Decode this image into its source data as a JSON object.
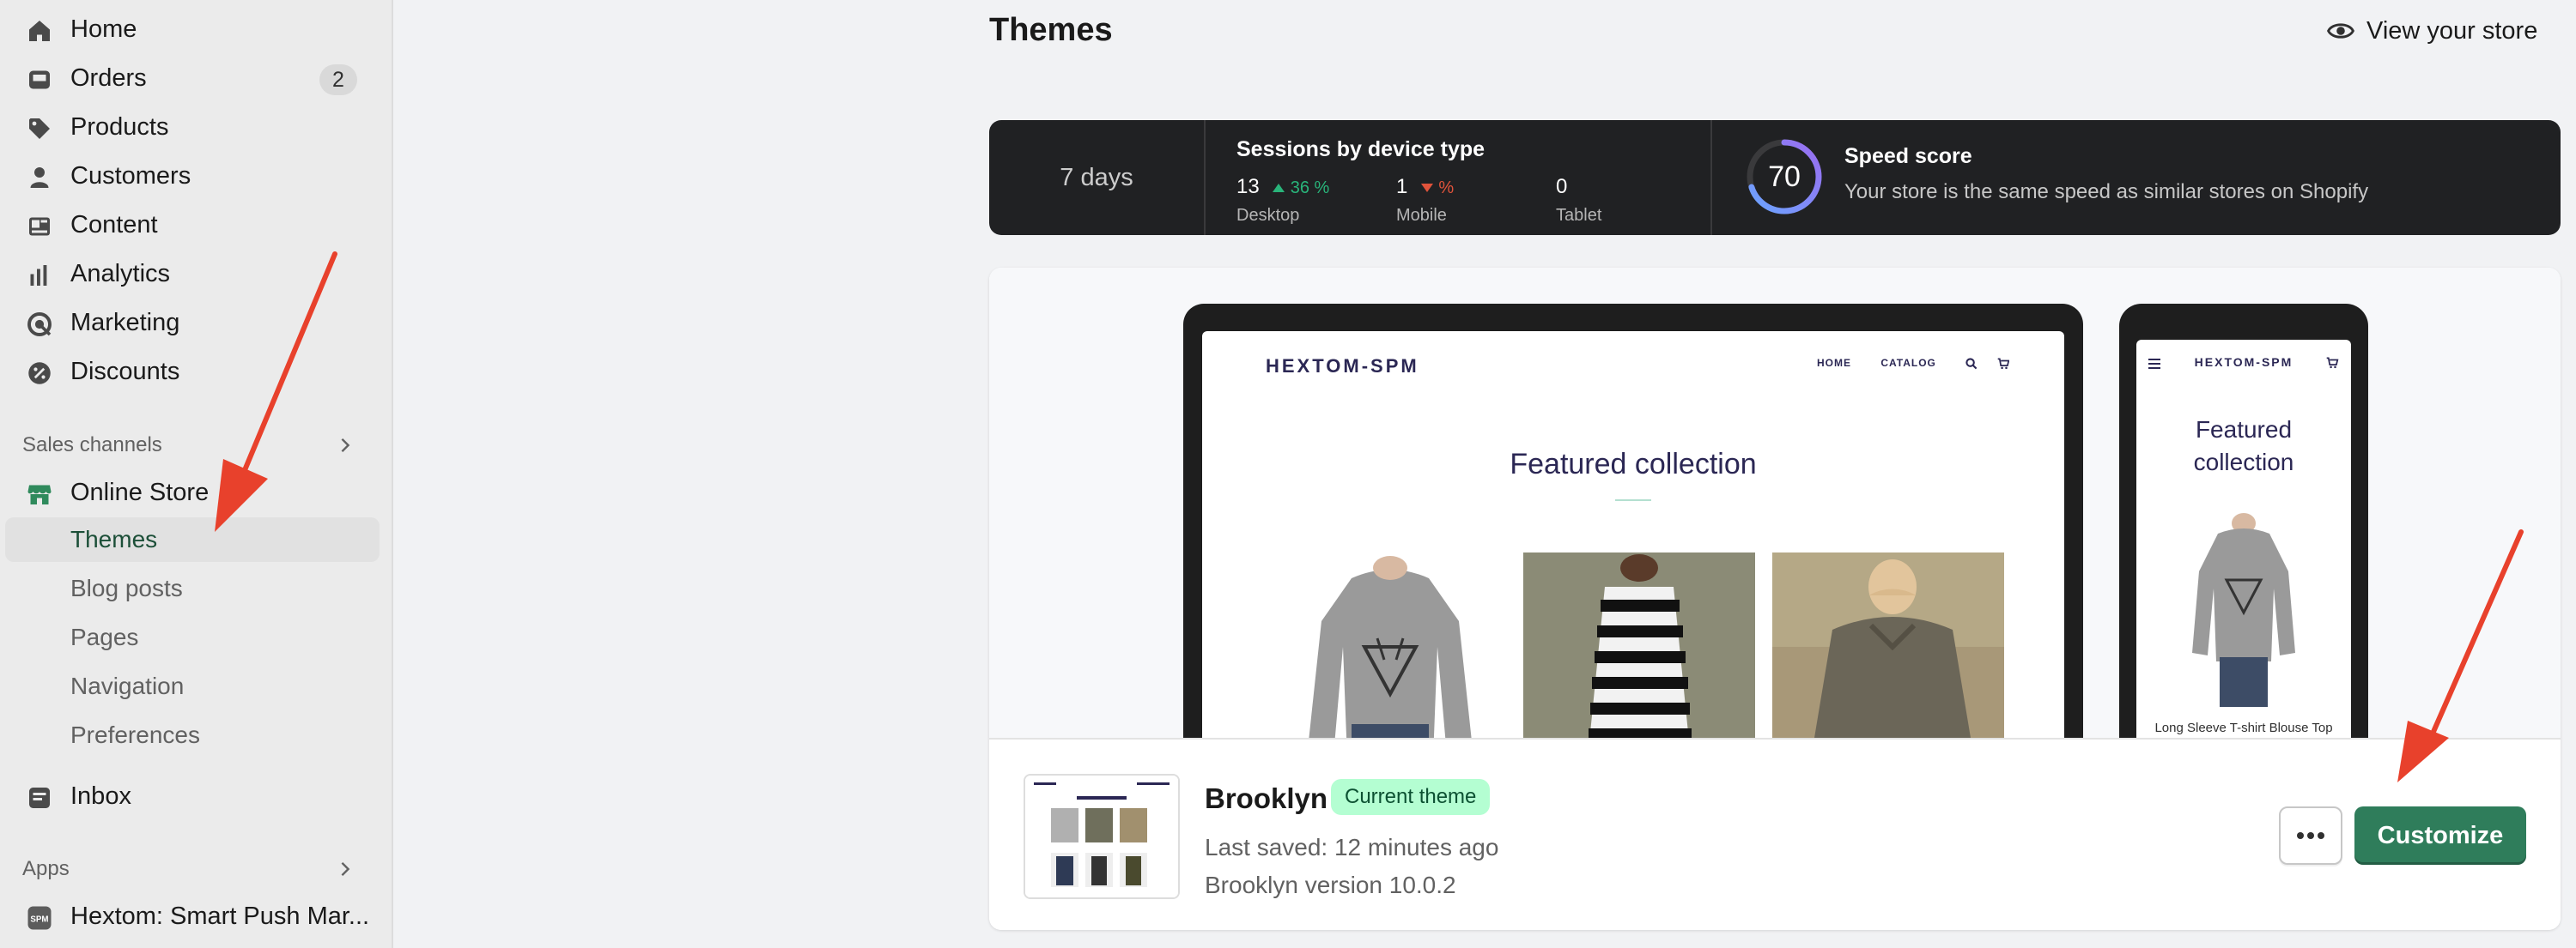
{
  "sidebar": {
    "items": [
      {
        "label": "Home",
        "icon": "home-icon"
      },
      {
        "label": "Orders",
        "icon": "inbox-tray-icon",
        "badge": "2"
      },
      {
        "label": "Products",
        "icon": "tag-icon"
      },
      {
        "label": "Customers",
        "icon": "person-icon"
      },
      {
        "label": "Content",
        "icon": "layout-icon"
      },
      {
        "label": "Analytics",
        "icon": "bar-chart-icon"
      },
      {
        "label": "Marketing",
        "icon": "target-icon"
      },
      {
        "label": "Discounts",
        "icon": "discount-icon"
      }
    ],
    "sales_channels": {
      "heading": "Sales channels",
      "online_store": "Online Store",
      "sub_items": [
        "Themes",
        "Blog posts",
        "Pages",
        "Navigation",
        "Preferences"
      ],
      "active": "Themes"
    },
    "inbox": "Inbox",
    "apps": {
      "heading": "Apps",
      "items": [
        {
          "label": "Hextom: Smart Push Mar...",
          "icon_text": "SPM"
        }
      ]
    }
  },
  "header": {
    "title": "Themes",
    "view_store": "View your store"
  },
  "stats": {
    "period": "7 days",
    "sessions_title": "Sessions by device type",
    "devices": [
      {
        "count": "13",
        "change": "36 %",
        "trend": "up",
        "label": "Desktop"
      },
      {
        "count": "1",
        "change": "%",
        "trend": "down",
        "label": "Mobile"
      },
      {
        "count": "0",
        "change": "",
        "trend": "none",
        "label": "Tablet"
      }
    ],
    "speed_score": 70,
    "speed_title": "Speed score",
    "speed_desc": "Your store is the same speed as similar stores on Shopify"
  },
  "preview": {
    "logo": "HEXTOM-SPM",
    "nav": [
      "HOME",
      "CATALOG"
    ],
    "featured": "Featured collection",
    "mobile_featured_line1": "Featured",
    "mobile_featured_line2": "collection",
    "mobile_caption": "Long Sleeve T-shirt Blouse Top"
  },
  "theme": {
    "name": "Brooklyn",
    "badge": "Current theme",
    "last_saved": "Last saved: 12 minutes ago",
    "version": "Brooklyn version 10.0.2",
    "customize": "Customize",
    "more_icon": "ellipsis-icon"
  },
  "colors": {
    "accent": "#2f7d5b",
    "annotation": "#e8412c",
    "badge_bg": "#b4fed2",
    "dark_bar": "#202123"
  }
}
